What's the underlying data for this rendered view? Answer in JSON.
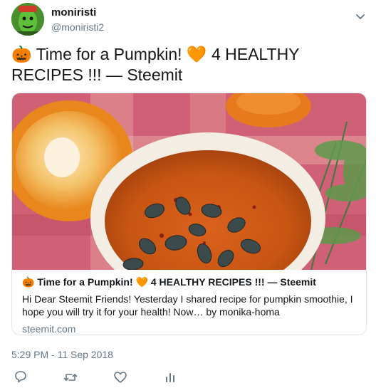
{
  "user": {
    "display_name": "moniristi",
    "handle": "@moniristi2",
    "avatar_icon": "green-face-avatar"
  },
  "tweet": {
    "text": "🎃 Time for a Pumpkin! 🧡 4 HEALTHY RECIPES !!! — Steemit",
    "timestamp": "5:29 PM - 11 Sep 2018"
  },
  "card": {
    "image": "pumpkin-soup-photo",
    "title": "🎃 Time for a Pumpkin! 🧡 4 HEALTHY RECIPES !!! — Steemit",
    "description": "Hi Dear Steemit Friends! Yesterday I shared recipe for pumpkin smoothie, I hope you will try it for your health! Now… by monika-homa",
    "domain": "steemit.com"
  },
  "actions": {
    "reply_icon": "reply-icon",
    "retweet_icon": "retweet-icon",
    "like_icon": "heart-icon",
    "analytics_icon": "analytics-icon"
  },
  "colors": {
    "text": "#14171a",
    "secondary": "#657786",
    "border": "#e1e8ed"
  }
}
